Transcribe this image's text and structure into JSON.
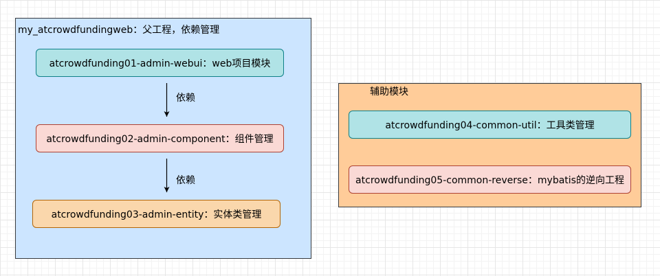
{
  "containers": {
    "main": {
      "title": "my_atcrowdfundingweb：父工程，依赖管理"
    },
    "aux": {
      "title": "辅助模块"
    }
  },
  "nodes": {
    "webui": "atcrowdfunding01-admin-webui：web项目模块",
    "component": "atcrowdfunding02-admin-component：组件管理",
    "entity": "atcrowdfunding03-admin-entity：实体类管理",
    "util": "atcrowdfunding04-common-util：工具类管理",
    "reverse": "atcrowdfunding05-common-reverse：mybatis的逆向工程"
  },
  "edges": [
    {
      "from": "webui",
      "to": "component",
      "label": "依赖"
    },
    {
      "from": "component",
      "to": "entity",
      "label": "依赖"
    }
  ],
  "colors": {
    "main_container_fill": "#cce5ff",
    "aux_container_fill": "#ffcc99",
    "teal_fill": "#b0e3e6",
    "teal_stroke": "#0e8088",
    "pink_fill": "#fad9d5",
    "pink_stroke": "#ae4132",
    "orange_fill": "#fad7ac",
    "orange_stroke": "#b46504"
  }
}
